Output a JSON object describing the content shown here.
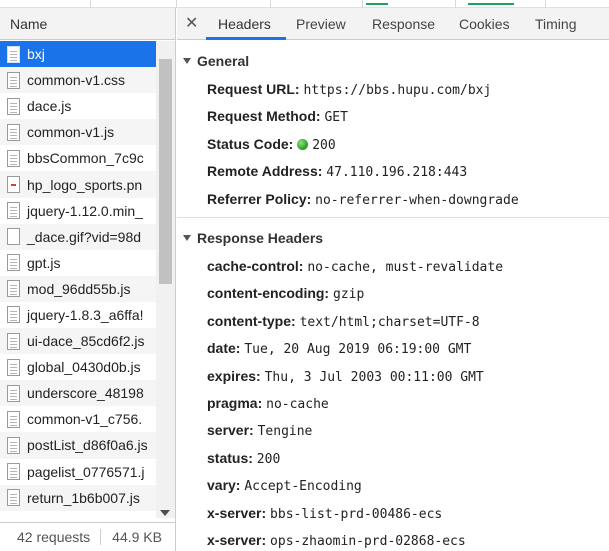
{
  "left": {
    "header": "Name",
    "files": [
      {
        "name": "bxj",
        "icon": "document-icon",
        "selected": true
      },
      {
        "name": "common-v1.css",
        "icon": "document-icon"
      },
      {
        "name": "dace.js",
        "icon": "document-icon"
      },
      {
        "name": "common-v1.js",
        "icon": "document-icon"
      },
      {
        "name": "bbsCommon_7c9c",
        "icon": "document-icon"
      },
      {
        "name": "hp_logo_sports.pn",
        "icon": "image-icon"
      },
      {
        "name": "jquery-1.12.0.min_",
        "icon": "document-icon"
      },
      {
        "name": "_dace.gif?vid=98d",
        "icon": "blank-file-icon"
      },
      {
        "name": "gpt.js",
        "icon": "document-icon"
      },
      {
        "name": "mod_96dd55b.js",
        "icon": "document-icon"
      },
      {
        "name": "jquery-1.8.3_a6ffa!",
        "icon": "document-icon"
      },
      {
        "name": "ui-dace_85cd6f2.js",
        "icon": "document-icon"
      },
      {
        "name": "global_0430d0b.js",
        "icon": "document-icon"
      },
      {
        "name": "underscore_48198",
        "icon": "document-icon"
      },
      {
        "name": "common-v1_c756.",
        "icon": "document-icon"
      },
      {
        "name": "postList_d86f0a6.js",
        "icon": "document-icon"
      },
      {
        "name": "pagelist_0776571.j",
        "icon": "document-icon"
      },
      {
        "name": "return_1b6b007.js",
        "icon": "document-icon"
      }
    ],
    "status": {
      "requests": "42 requests",
      "size": "44.9 KB"
    }
  },
  "tabs": [
    {
      "label": "Headers",
      "active": true
    },
    {
      "label": "Preview"
    },
    {
      "label": "Response"
    },
    {
      "label": "Cookies"
    },
    {
      "label": "Timing"
    }
  ],
  "general": {
    "title": "General",
    "rows": [
      {
        "key": "Request URL:",
        "value": "https://bbs.hupu.com/bxj"
      },
      {
        "key": "Request Method:",
        "value": "GET"
      },
      {
        "key": "Status Code:",
        "value": "200",
        "dot": true
      },
      {
        "key": "Remote Address:",
        "value": "47.110.196.218:443"
      },
      {
        "key": "Referrer Policy:",
        "value": "no-referrer-when-downgrade"
      }
    ]
  },
  "response_headers": {
    "title": "Response Headers",
    "rows": [
      {
        "key": "cache-control:",
        "value": "no-cache, must-revalidate"
      },
      {
        "key": "content-encoding:",
        "value": "gzip"
      },
      {
        "key": "content-type:",
        "value": "text/html;charset=UTF-8"
      },
      {
        "key": "date:",
        "value": "Tue, 20 Aug 2019 06:19:00 GMT"
      },
      {
        "key": "expires:",
        "value": "Thu, 3 Jul 2003 00:11:00 GMT"
      },
      {
        "key": "pragma:",
        "value": "no-cache"
      },
      {
        "key": "server:",
        "value": "Tengine"
      },
      {
        "key": "status:",
        "value": "200"
      },
      {
        "key": "vary:",
        "value": "Accept-Encoding"
      },
      {
        "key": "x-server:",
        "value": "bbs-list-prd-00486-ecs"
      },
      {
        "key": "x-server:",
        "value": "ops-zhaomin-prd-02868-ecs"
      }
    ]
  },
  "colors": {
    "accent": "#1a73e8",
    "status_ok": "#1e9e1e"
  }
}
